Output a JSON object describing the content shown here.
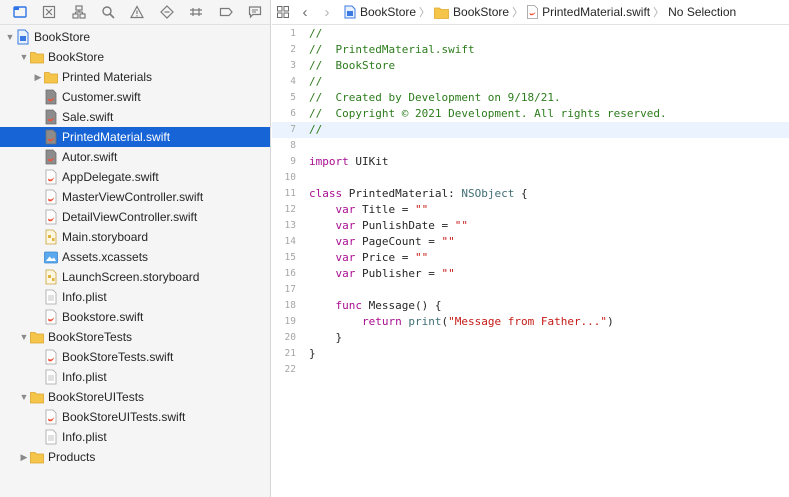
{
  "navigator": {
    "items": [
      {
        "label": "BookStore",
        "depth": 0,
        "disclosure": "expanded",
        "icon": "project-icon"
      },
      {
        "label": "BookStore",
        "depth": 1,
        "disclosure": "expanded",
        "icon": "folder-icon"
      },
      {
        "label": "Printed Materials",
        "depth": 2,
        "disclosure": "collapsed",
        "icon": "folder-icon"
      },
      {
        "label": "Customer.swift",
        "depth": 2,
        "disclosure": "none",
        "icon": "swift-file-modified-icon"
      },
      {
        "label": "Sale.swift",
        "depth": 2,
        "disclosure": "none",
        "icon": "swift-file-modified-icon"
      },
      {
        "label": "PrintedMaterial.swift",
        "depth": 2,
        "disclosure": "none",
        "icon": "swift-file-modified-icon",
        "selected": true
      },
      {
        "label": "Autor.swift",
        "depth": 2,
        "disclosure": "none",
        "icon": "swift-file-modified-icon"
      },
      {
        "label": "AppDelegate.swift",
        "depth": 2,
        "disclosure": "none",
        "icon": "swift-file-icon"
      },
      {
        "label": "MasterViewController.swift",
        "depth": 2,
        "disclosure": "none",
        "icon": "swift-file-icon"
      },
      {
        "label": "DetailViewController.swift",
        "depth": 2,
        "disclosure": "none",
        "icon": "swift-file-icon"
      },
      {
        "label": "Main.storyboard",
        "depth": 2,
        "disclosure": "none",
        "icon": "storyboard-file-icon"
      },
      {
        "label": "Assets.xcassets",
        "depth": 2,
        "disclosure": "none",
        "icon": "asset-catalog-icon"
      },
      {
        "label": "LaunchScreen.storyboard",
        "depth": 2,
        "disclosure": "none",
        "icon": "storyboard-file-icon"
      },
      {
        "label": "Info.plist",
        "depth": 2,
        "disclosure": "none",
        "icon": "plist-file-icon"
      },
      {
        "label": "Bookstore.swift",
        "depth": 2,
        "disclosure": "none",
        "icon": "swift-file-icon"
      },
      {
        "label": "BookStoreTests",
        "depth": 1,
        "disclosure": "expanded",
        "icon": "folder-icon"
      },
      {
        "label": "BookStoreTests.swift",
        "depth": 2,
        "disclosure": "none",
        "icon": "swift-file-icon"
      },
      {
        "label": "Info.plist",
        "depth": 2,
        "disclosure": "none",
        "icon": "plist-file-icon"
      },
      {
        "label": "BookStoreUITests",
        "depth": 1,
        "disclosure": "expanded",
        "icon": "folder-icon"
      },
      {
        "label": "BookStoreUITests.swift",
        "depth": 2,
        "disclosure": "none",
        "icon": "swift-file-icon"
      },
      {
        "label": "Info.plist",
        "depth": 2,
        "disclosure": "none",
        "icon": "plist-file-icon"
      },
      {
        "label": "Products",
        "depth": 1,
        "disclosure": "collapsed",
        "icon": "folder-icon"
      }
    ]
  },
  "jumpbar": {
    "project": "BookStore",
    "group": "BookStore",
    "file": "PrintedMaterial.swift",
    "symbol": "No Selection"
  },
  "editor": {
    "current_line": 7,
    "lines": [
      [
        [
          "c",
          "//"
        ]
      ],
      [
        [
          "c",
          "//  PrintedMaterial.swift"
        ]
      ],
      [
        [
          "c",
          "//  BookStore"
        ]
      ],
      [
        [
          "c",
          "//"
        ]
      ],
      [
        [
          "c",
          "//  Created by Development on 9/18/21."
        ]
      ],
      [
        [
          "c",
          "//  Copyright © 2021 Development. All rights reserved."
        ]
      ],
      [
        [
          "c",
          "//"
        ]
      ],
      [],
      [
        [
          "k",
          "import"
        ],
        [
          "p",
          " UIKit"
        ]
      ],
      [],
      [
        [
          "k",
          "class"
        ],
        [
          "p",
          " PrintedMaterial: "
        ],
        [
          "t",
          "NSObject"
        ],
        [
          "p",
          " {"
        ]
      ],
      [
        [
          "p",
          "    "
        ],
        [
          "k",
          "var"
        ],
        [
          "p",
          " Title = "
        ],
        [
          "s",
          "\"\""
        ]
      ],
      [
        [
          "p",
          "    "
        ],
        [
          "k",
          "var"
        ],
        [
          "p",
          " PunlishDate = "
        ],
        [
          "s",
          "\"\""
        ]
      ],
      [
        [
          "p",
          "    "
        ],
        [
          "k",
          "var"
        ],
        [
          "p",
          " PageCount = "
        ],
        [
          "s",
          "\"\""
        ]
      ],
      [
        [
          "p",
          "    "
        ],
        [
          "k",
          "var"
        ],
        [
          "p",
          " Price = "
        ],
        [
          "s",
          "\"\""
        ]
      ],
      [
        [
          "p",
          "    "
        ],
        [
          "k",
          "var"
        ],
        [
          "p",
          " Publisher = "
        ],
        [
          "s",
          "\"\""
        ]
      ],
      [],
      [
        [
          "p",
          "    "
        ],
        [
          "k",
          "func"
        ],
        [
          "p",
          " Message() {"
        ]
      ],
      [
        [
          "p",
          "        "
        ],
        [
          "k",
          "return"
        ],
        [
          "p",
          " "
        ],
        [
          "t",
          "print"
        ],
        [
          "p",
          "("
        ],
        [
          "s",
          "\"Message from Father...\""
        ],
        [
          "p",
          ")"
        ]
      ],
      [
        [
          "p",
          "    }"
        ]
      ],
      [
        [
          "p",
          "}"
        ]
      ],
      []
    ]
  },
  "colors": {
    "selection": "#1764d6",
    "comment": "#2c7c1c",
    "keyword": "#a90d91",
    "string": "#c41a16",
    "type": "#3f6e74",
    "folder": "#f5c54a",
    "current_line": "#ebf3fe"
  }
}
